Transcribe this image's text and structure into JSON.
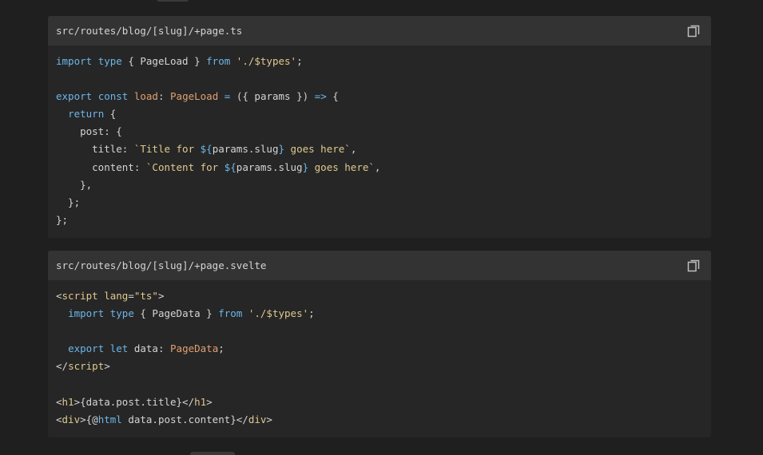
{
  "blocks": [
    {
      "filename": "src/routes/blog/[slug]/+page.ts",
      "copy_icon": "copy-icon",
      "lines": [
        [
          [
            "kw",
            "import"
          ],
          [
            "pl",
            " "
          ],
          [
            "kw",
            "type"
          ],
          [
            "pl",
            " { PageLoad } "
          ],
          [
            "kw",
            "from"
          ],
          [
            "pl",
            " "
          ],
          [
            "str",
            "'./$types'"
          ],
          [
            "pl",
            ";"
          ]
        ],
        [],
        [
          [
            "kw",
            "export"
          ],
          [
            "pl",
            " "
          ],
          [
            "kw",
            "const"
          ],
          [
            "pl",
            " "
          ],
          [
            "fn",
            "load"
          ],
          [
            "pl",
            ": "
          ],
          [
            "ty",
            "PageLoad"
          ],
          [
            "pl",
            " "
          ],
          [
            "kw",
            "="
          ],
          [
            "pl",
            " ({ params }) "
          ],
          [
            "kw",
            "=>"
          ],
          [
            "pl",
            " {"
          ]
        ],
        [
          [
            "pl",
            "  "
          ],
          [
            "kw",
            "return"
          ],
          [
            "pl",
            " {"
          ]
        ],
        [
          [
            "pl",
            "    post: {"
          ]
        ],
        [
          [
            "pl",
            "      title: "
          ],
          [
            "str",
            "`Title for "
          ],
          [
            "kw",
            "${"
          ],
          [
            "pl",
            "params.slug"
          ],
          [
            "kw",
            "}"
          ],
          [
            "str",
            " goes here`"
          ],
          [
            "pl",
            ","
          ]
        ],
        [
          [
            "pl",
            "      content: "
          ],
          [
            "str",
            "`Content for "
          ],
          [
            "kw",
            "${"
          ],
          [
            "pl",
            "params.slug"
          ],
          [
            "kw",
            "}"
          ],
          [
            "str",
            " goes here`"
          ],
          [
            "pl",
            ","
          ]
        ],
        [
          [
            "pl",
            "    },"
          ]
        ],
        [
          [
            "pl",
            "  };"
          ]
        ],
        [
          [
            "pl",
            "};"
          ]
        ]
      ]
    },
    {
      "filename": "src/routes/blog/[slug]/+page.svelte",
      "copy_icon": "copy-icon",
      "lines": [
        [
          [
            "pl",
            "<"
          ],
          [
            "tag",
            "script"
          ],
          [
            "pl",
            " "
          ],
          [
            "attr",
            "lang"
          ],
          [
            "pl",
            "="
          ],
          [
            "str",
            "\"ts\""
          ],
          [
            "pl",
            ">"
          ]
        ],
        [
          [
            "pl",
            "  "
          ],
          [
            "kw",
            "import"
          ],
          [
            "pl",
            " "
          ],
          [
            "kw",
            "type"
          ],
          [
            "pl",
            " { PageData } "
          ],
          [
            "kw",
            "from"
          ],
          [
            "pl",
            " "
          ],
          [
            "str",
            "'./$types'"
          ],
          [
            "pl",
            ";"
          ]
        ],
        [],
        [
          [
            "pl",
            "  "
          ],
          [
            "kw",
            "export"
          ],
          [
            "pl",
            " "
          ],
          [
            "kw",
            "let"
          ],
          [
            "pl",
            " data: "
          ],
          [
            "ty",
            "PageData"
          ],
          [
            "pl",
            ";"
          ]
        ],
        [
          [
            "pl",
            "</"
          ],
          [
            "tag",
            "script"
          ],
          [
            "pl",
            ">"
          ]
        ],
        [],
        [
          [
            "pl",
            "<"
          ],
          [
            "tag",
            "h1"
          ],
          [
            "pl",
            ">{data.post.title}</"
          ],
          [
            "tag",
            "h1"
          ],
          [
            "pl",
            ">"
          ]
        ],
        [
          [
            "pl",
            "<"
          ],
          [
            "tag",
            "div"
          ],
          [
            "pl",
            ">{@"
          ],
          [
            "kw",
            "html"
          ],
          [
            "pl",
            " data.post.content}</"
          ],
          [
            "tag",
            "div"
          ],
          [
            "pl",
            ">"
          ]
        ]
      ]
    }
  ]
}
